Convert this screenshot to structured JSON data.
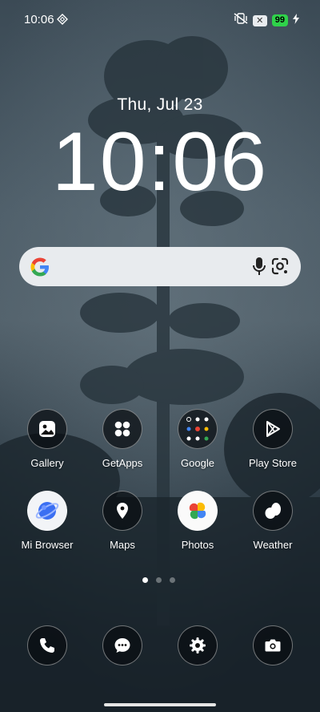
{
  "status_bar": {
    "time": "10:06",
    "battery_level": "99",
    "battery_color": "#2fd24a",
    "icons": [
      "tag-icon",
      "vibrate-off-icon",
      "x-notification-icon",
      "battery-icon",
      "charging-bolt-icon"
    ]
  },
  "clock": {
    "date": "Thu, Jul 23",
    "time": "10:06"
  },
  "search": {
    "icons": [
      "google-logo-icon",
      "microphone-icon",
      "google-lens-icon"
    ]
  },
  "apps": [
    {
      "label": "Gallery",
      "icon": "gallery-icon"
    },
    {
      "label": "GetApps",
      "icon": "getapps-icon"
    },
    {
      "label": "Google",
      "icon": "google-folder-icon"
    },
    {
      "label": "Play Store",
      "icon": "play-store-icon"
    },
    {
      "label": "Mi Browser",
      "icon": "mi-browser-icon"
    },
    {
      "label": "Maps",
      "icon": "maps-icon"
    },
    {
      "label": "Photos",
      "icon": "google-photos-icon"
    },
    {
      "label": "Weather",
      "icon": "weather-icon"
    }
  ],
  "page_indicator": {
    "pages": 3,
    "current": 1
  },
  "dock": [
    {
      "icon": "phone-icon"
    },
    {
      "icon": "messages-icon"
    },
    {
      "icon": "settings-icon"
    },
    {
      "icon": "camera-icon"
    }
  ]
}
